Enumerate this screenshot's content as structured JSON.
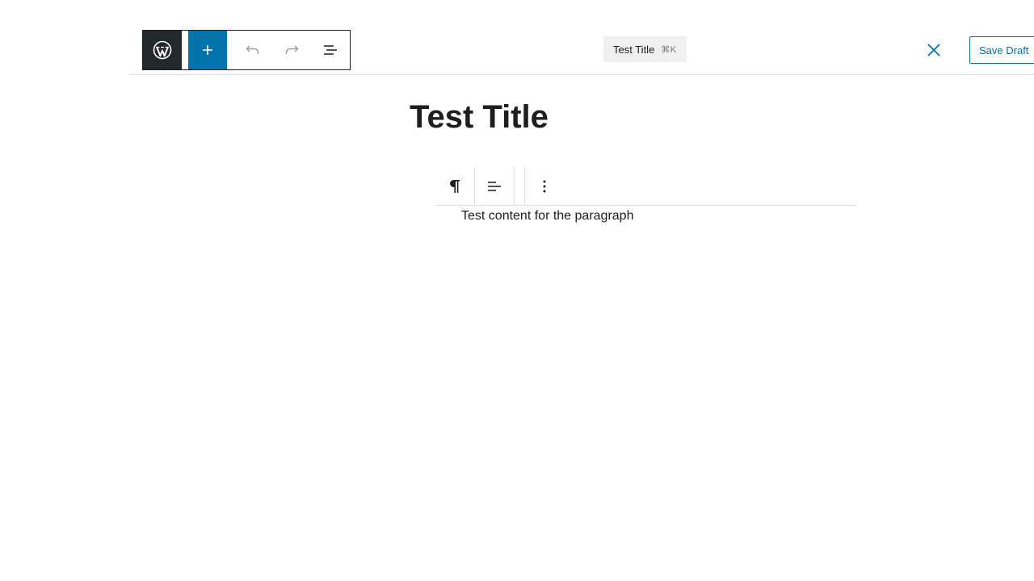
{
  "header": {
    "document_title": "Test Title",
    "shortcut": "⌘K",
    "save_draft_label": "Save Draft"
  },
  "icons": {
    "logo": "wordpress-icon",
    "add": "plus-icon",
    "undo": "undo-icon",
    "redo": "redo-icon",
    "outline": "document-overview-icon",
    "close": "close-icon",
    "paragraph": "pilcrow-icon",
    "align": "align-left-icon",
    "more": "more-vertical-icon"
  },
  "colors": {
    "accent": "#0073aa",
    "logo_bg": "#23282d",
    "text": "#1e1e1e"
  },
  "content": {
    "post_title": "Test Title",
    "paragraph_text": "Test content for the paragraph"
  }
}
